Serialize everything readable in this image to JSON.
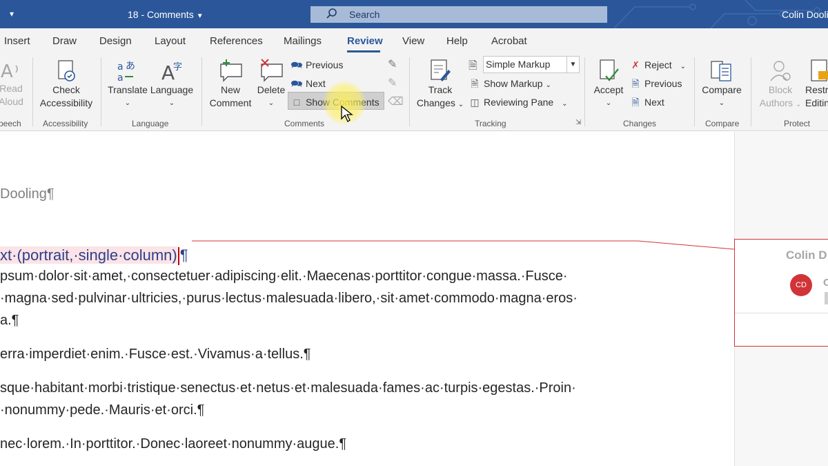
{
  "titlebar": {
    "doc_title": "18 - Comments",
    "search_placeholder": "Search",
    "user": "Colin Dooling"
  },
  "tabs": [
    "Insert",
    "Draw",
    "Design",
    "Layout",
    "References",
    "Mailings",
    "Review",
    "View",
    "Help",
    "Acrobat"
  ],
  "active_tab": "Review",
  "ribbon": {
    "speech": {
      "read_aloud_1": "Read",
      "read_aloud_2": "Aloud",
      "group": "peech"
    },
    "accessibility": {
      "check_1": "Check",
      "check_2": "Accessibility",
      "group": "Accessibility"
    },
    "language": {
      "translate": "Translate",
      "language": "Language",
      "group": "Language"
    },
    "comments": {
      "new_1": "New",
      "new_2": "Comment",
      "delete": "Delete",
      "previous": "Previous",
      "next": "Next",
      "show_comments": "Show Comments",
      "group": "Comments"
    },
    "tracking": {
      "track_1": "Track",
      "track_2": "Changes",
      "markup_value": "Simple Markup",
      "show_markup": "Show Markup",
      "reviewing_pane": "Reviewing Pane",
      "group": "Tracking"
    },
    "changes": {
      "accept": "Accept",
      "reject": "Reject",
      "previous": "Previous",
      "next": "Next",
      "group": "Changes"
    },
    "compare": {
      "compare": "Compare",
      "group": "Compare"
    },
    "protect": {
      "block_1": "Block",
      "block_2": "Authors",
      "restrict_1": "Restri",
      "restrict_2": "Editin",
      "group": "Protect"
    }
  },
  "document": {
    "author_line": "Dooling¶",
    "heading_text": "xt·(portrait,·single·column)",
    "heading_mark": "¶",
    "paragraphs": [
      "psum·dolor·sit·amet,·consectetuer·adipiscing·elit.·Maecenas·porttitor·congue·massa.·Fusce·",
      "·magna·sed·pulvinar·ultricies,·purus·lectus·malesuada·libero,·sit·amet·commodo·magna·eros·",
      "a.¶",
      "erra·imperdiet·enim.·Fusce·est.·Vivamus·a·tellus.¶",
      "sque·habitant·morbi·tristique·senectus·et·netus·et·malesuada·fames·ac·turpis·egestas.·Proin·",
      "·nonummy·pede.·Mauris·et·orci.¶",
      "nec·lorem.·In·porttitor.·Donec·laoreet·nonummy·augue.¶"
    ]
  },
  "comment": {
    "author": "Colin D",
    "initials": "CD",
    "faint_letter": "C"
  },
  "colors": {
    "accent": "#2b579a",
    "comment_border": "#d13438",
    "highlight": "#fbe3e6"
  }
}
